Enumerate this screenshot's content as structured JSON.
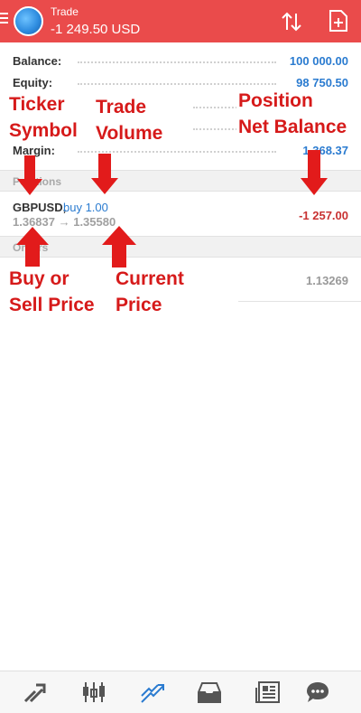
{
  "header": {
    "title": "Trade",
    "subtitle": "-1 249.50 USD",
    "accent_color": "#ea4b4b"
  },
  "summary": [
    {
      "label": "Balance:",
      "value": "100 000.00"
    },
    {
      "label": "Equity:",
      "value": "98 750.50"
    },
    {
      "label": "Margin:",
      "value": "1 368.37"
    }
  ],
  "sections": {
    "positions": "Positions",
    "orders": "Orders"
  },
  "position": {
    "symbol": "GBPUSD,",
    "volume": "buy 1.00",
    "prices": "1.36837 → 1.35580",
    "profit": "-1 257.00"
  },
  "orders": {
    "value": "1.13269"
  },
  "annotations": {
    "ticker_line1": "Ticker",
    "ticker_line2": "Symbol",
    "volume_line1": "Trade",
    "volume_line2": "Volume",
    "position_line1": "Position",
    "position_line2": "Net Balance",
    "buy_line1": "Buy or",
    "buy_line2": "Sell Price",
    "current_line1": "Current",
    "current_line2": "Price",
    "color": "#d61a1a"
  },
  "nav": {
    "items": [
      "quotes-icon",
      "chart-icon",
      "trade-icon",
      "history-icon",
      "news-icon",
      "chat-icon"
    ],
    "active": "trade-icon",
    "active_color": "#2a7bd0"
  }
}
